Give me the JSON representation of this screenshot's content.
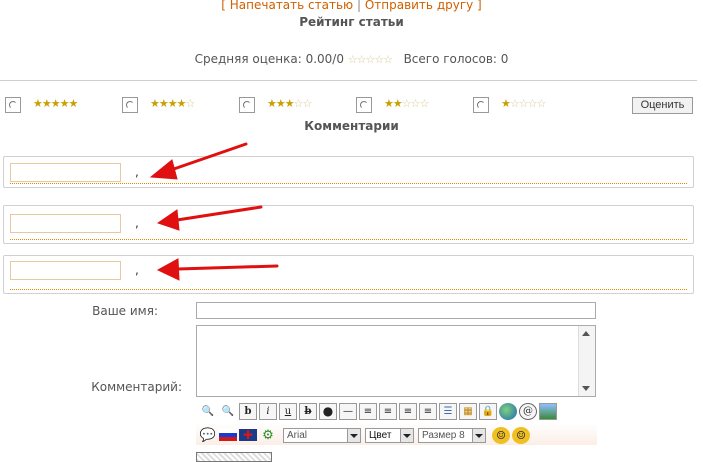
{
  "links": {
    "open": "[ ",
    "print": "Напечатать статью",
    "sep": " | ",
    "send": "Отправить другу",
    "close": " ]"
  },
  "rating": {
    "title": "Рейтинг статьи",
    "average_label": "Средняя оценка: 0.00/0",
    "votes_label": "Всего голосов: 0",
    "average_stars": 0,
    "options": [
      5,
      4,
      3,
      2,
      1
    ],
    "rate_button": "Оценить"
  },
  "comments": {
    "title": "Комментарии",
    "items": [
      {
        "separator": ","
      },
      {
        "separator": ","
      },
      {
        "separator": ","
      }
    ]
  },
  "form": {
    "name_label": "Ваше имя:",
    "name_value": "",
    "comment_label": "Комментарий:",
    "comment_value": "",
    "font_select": "Arial",
    "color_select": "Цвет",
    "size_select": "Размер 8"
  },
  "colors": {
    "accent": "#d06000",
    "dotted": "#e08a00",
    "arrow": "#e01010",
    "star": "#c9a000"
  }
}
